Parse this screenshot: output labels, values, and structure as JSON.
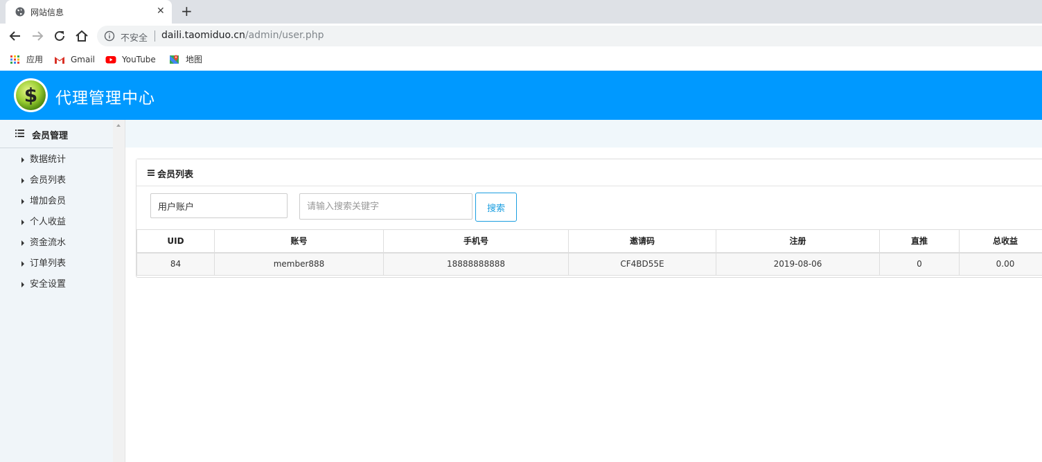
{
  "browser": {
    "tab_title": "网站信息",
    "tab_close": "✕",
    "new_tab": "+",
    "insecure_label": "不安全",
    "url_host": "daili.taomiduo.cn",
    "url_path": "/admin/user.php",
    "bookmarks": [
      {
        "label": "应用",
        "icon": "apps-grid-icon"
      },
      {
        "label": "Gmail",
        "icon": "gmail-icon"
      },
      {
        "label": "YouTube",
        "icon": "youtube-icon"
      },
      {
        "label": "地图",
        "icon": "maps-icon"
      }
    ]
  },
  "header": {
    "title": "代理管理中心",
    "logo_glyph": "$",
    "brand_color": "#0099ff"
  },
  "sidebar": {
    "section_title": "会员管理",
    "items": [
      {
        "label": "数据统计"
      },
      {
        "label": "会员列表"
      },
      {
        "label": "增加会员"
      },
      {
        "label": "个人收益"
      },
      {
        "label": "资金流水"
      },
      {
        "label": "订单列表"
      },
      {
        "label": "安全设置"
      }
    ]
  },
  "main": {
    "panel_title": "会员列表",
    "filter": {
      "selected_field": "用户账户",
      "search_placeholder": "请输入搜索关键字",
      "search_value": "",
      "search_button": "搜索"
    },
    "table": {
      "columns": [
        "UID",
        "账号",
        "手机号",
        "邀请码",
        "注册",
        "直推",
        "总收益"
      ],
      "rows": [
        [
          "84",
          "member888",
          "18888888888",
          "CF4BD55E",
          "2019-08-06",
          "0",
          "0.00"
        ]
      ]
    }
  }
}
